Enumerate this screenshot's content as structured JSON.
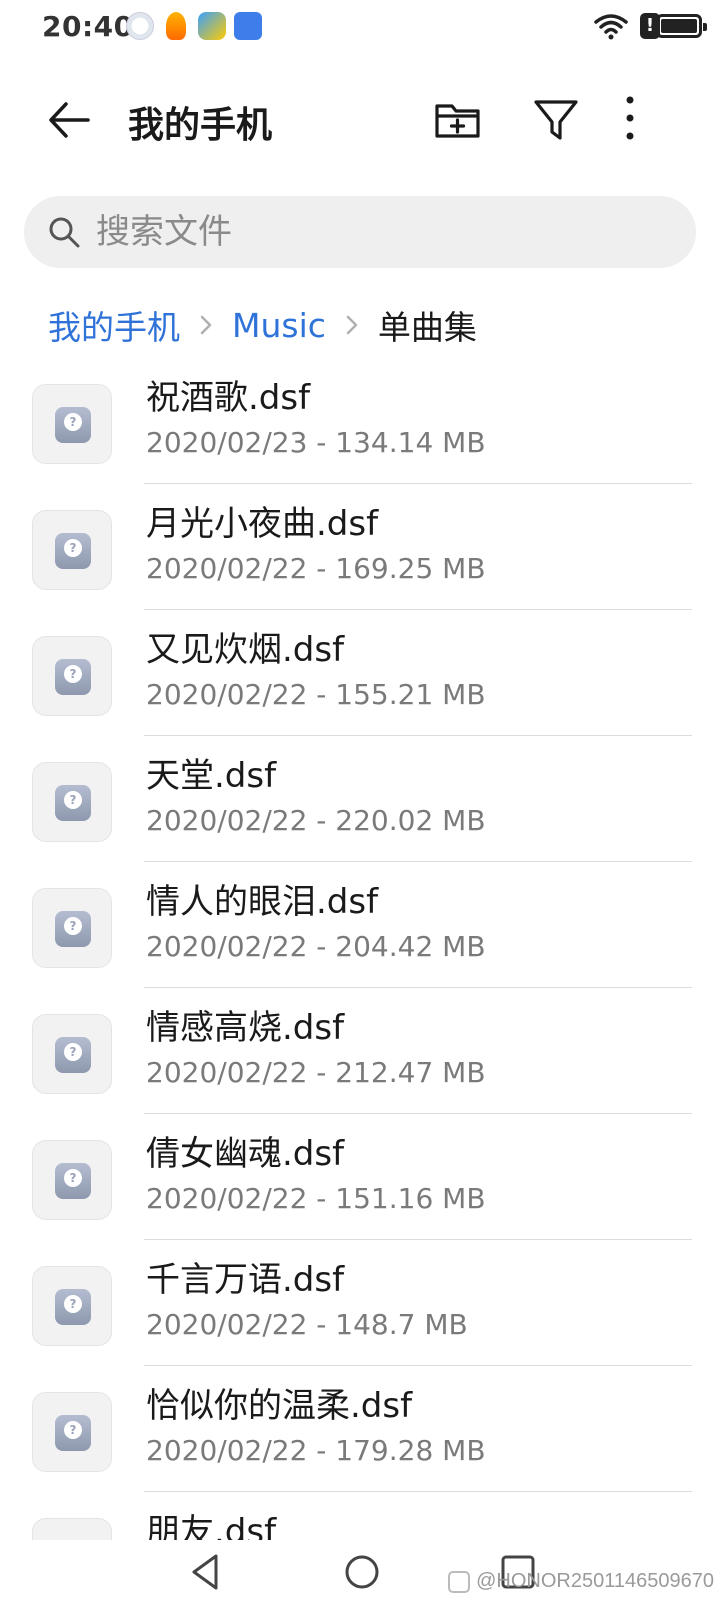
{
  "status_bar": {
    "time": "20:40",
    "icons": [
      "weather-icon",
      "honor-app-icon",
      "pin-app-icon",
      "shield-app-icon",
      "wifi-icon",
      "alert-icon",
      "battery-icon"
    ],
    "alert_glyph": "!"
  },
  "toolbar": {
    "title": "我的手机",
    "actions": [
      "new-folder-icon",
      "filter-icon",
      "more-vertical-icon"
    ]
  },
  "search": {
    "placeholder": "搜索文件",
    "value": ""
  },
  "breadcrumb": {
    "items": [
      {
        "label": "我的手机",
        "link": true
      },
      {
        "label": "Music",
        "link": true
      },
      {
        "label": "单曲集",
        "link": false
      }
    ]
  },
  "files": [
    {
      "name": "祝酒歌.dsf",
      "meta": "2020/02/23 - 134.14 MB"
    },
    {
      "name": "月光小夜曲.dsf",
      "meta": "2020/02/22 - 169.25 MB"
    },
    {
      "name": "又见炊烟.dsf",
      "meta": "2020/02/22 - 155.21 MB"
    },
    {
      "name": "天堂.dsf",
      "meta": "2020/02/22 - 220.02 MB"
    },
    {
      "name": "情人的眼泪.dsf",
      "meta": "2020/02/22 - 204.42 MB"
    },
    {
      "name": "情感高烧.dsf",
      "meta": "2020/02/22 - 212.47 MB"
    },
    {
      "name": "倩女幽魂.dsf",
      "meta": "2020/02/22 - 151.16 MB"
    },
    {
      "name": "千言万语.dsf",
      "meta": "2020/02/22 - 148.7 MB"
    },
    {
      "name": "恰似你的温柔.dsf",
      "meta": "2020/02/22 - 179.28 MB"
    },
    {
      "name": "朋友.dsf",
      "meta": ""
    }
  ],
  "navbar": {
    "buttons": [
      "back-triangle-icon",
      "home-circle-icon",
      "recent-square-icon"
    ],
    "watermark": "@HONOR2501146509670"
  },
  "colors": {
    "accent": "#2f73d9",
    "search_bg": "#efefef",
    "meta_text": "#7a7a7a"
  }
}
